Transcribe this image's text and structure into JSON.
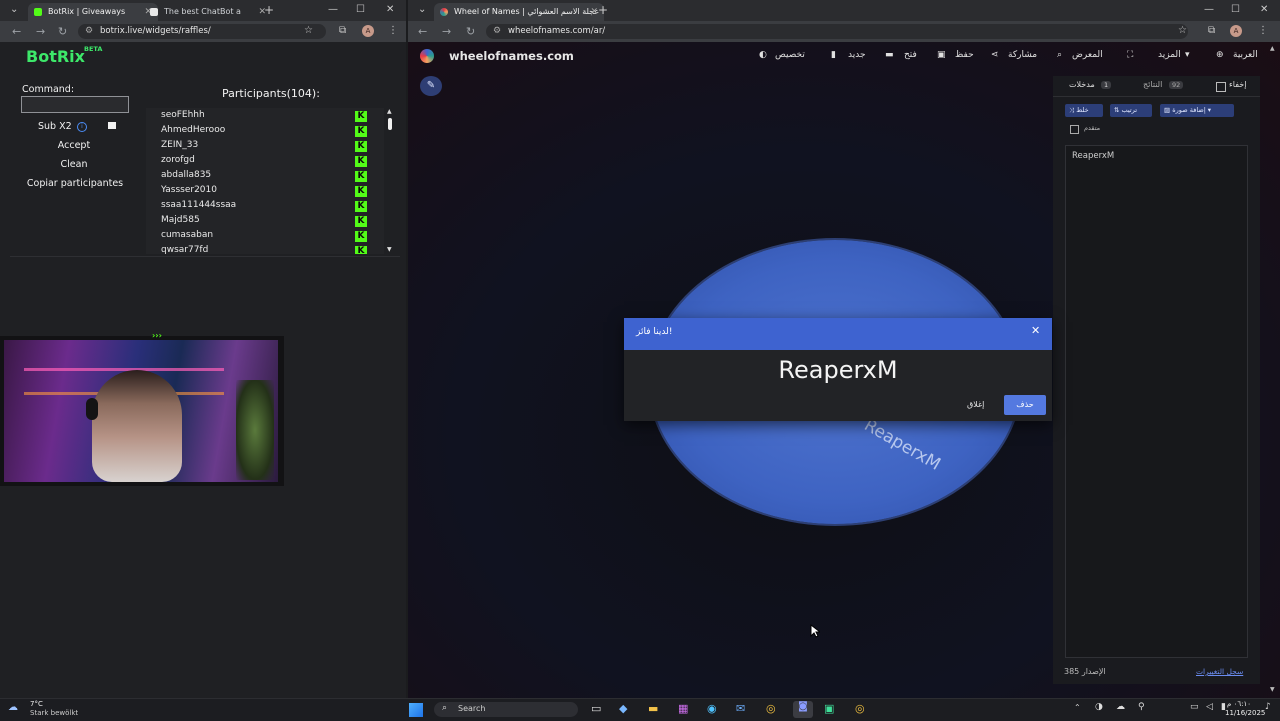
{
  "left_browser": {
    "tabs": [
      {
        "label": "BotRix | Giveaways",
        "active": true
      },
      {
        "label": "The best ChatBot a",
        "active": false
      }
    ],
    "url": "botrix.live/widgets/raffles/",
    "profile_initial": "A"
  },
  "botrix": {
    "logo": "BotRix",
    "beta": "BETA",
    "command_label": "Command:",
    "command_value": "",
    "sub_label": "Sub X2",
    "accept_label": "Accept",
    "clean_label": "Clean",
    "copy_label": "Copiar participantes",
    "participants_title": "Participants(104):",
    "participants": [
      "seoFEhhh",
      "AhmedHerooo",
      "ZEIN_33",
      "zorofgd",
      "abdalla835",
      "Yassser2010",
      "ssaa111444ssaa",
      "Majd585",
      "cumasaban",
      "qwsar77fd"
    ],
    "kick_glyph": "K"
  },
  "right_browser": {
    "tabs": [
      {
        "label": "Wheel of Names | عجلة الاسم العشوائي",
        "active": true
      }
    ],
    "url": "wheelofnames.com/ar/",
    "profile_initial": "A"
  },
  "wheel": {
    "site_name": "wheelofnames.com",
    "toolbar": {
      "customize": "تخصيص",
      "new": "جديد",
      "open": "فتح",
      "save": "حفظ",
      "share": "مشاركة",
      "gallery": "المعرض",
      "more": "المزيد",
      "language": "العربية"
    },
    "panel": {
      "hide": "إخفاء",
      "results_tab": "النتائج",
      "results_count": "92",
      "entries_tab": "مدخلات",
      "entries_count": "1",
      "shuffle": "خلط",
      "sort": "ترتيب",
      "add_image": "إضافة صورة",
      "advanced": "متقدم",
      "entries": [
        "ReaperxM"
      ],
      "version": "الإصدار 385",
      "changelog": "سجل التغييرات"
    },
    "wheel_text": "ReaperxM",
    "dialog": {
      "title": "لدينا فائز!",
      "winner": "ReaperxM",
      "close_label": "إغلاق",
      "remove_label": "حذف"
    },
    "colors": {
      "accent": "#3e63d0",
      "wheel": "#4a6fcb"
    }
  },
  "taskbar": {
    "weather_temp": "7°C",
    "weather_desc": "Stark bewölkt",
    "search_placeholder": "Search",
    "time": "٠٦:١٠ م",
    "date": "11/16/2025"
  }
}
